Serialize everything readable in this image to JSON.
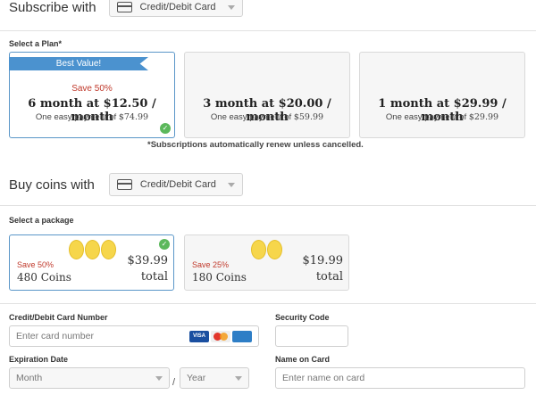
{
  "subscribe": {
    "heading": "Subscribe with",
    "payment_method": "Credit/Debit Card",
    "select_plan_label": "Select a Plan*",
    "plans": [
      {
        "ribbon": "Best Value!",
        "save": "Save 50%",
        "price": "6 month at $12.50 / month",
        "payment_prefix": "One easy payment of ",
        "payment_amount": "$74.99",
        "selected": true
      },
      {
        "ribbon": "",
        "save": "",
        "price": "3 month at $20.00 / month",
        "payment_prefix": "One easy payment of ",
        "payment_amount": "$59.99",
        "selected": false
      },
      {
        "ribbon": "",
        "save": "",
        "price": "1 month at $29.99 / month",
        "payment_prefix": "One easy payment of ",
        "payment_amount": "$29.99",
        "selected": false
      }
    ],
    "renew_note": "*Subscriptions automatically renew unless cancelled."
  },
  "coins": {
    "heading": "Buy coins with",
    "payment_method": "Credit/Debit Card",
    "select_package_label": "Select a package",
    "packages": [
      {
        "save": "Save 50%",
        "count": "480 Coins",
        "price": "$39.99",
        "total": "total",
        "coin_count": 3,
        "selected": true
      },
      {
        "save": "Save 25%",
        "count": "180 Coins",
        "price": "$19.99",
        "total": "total",
        "coin_count": 2,
        "selected": false
      }
    ]
  },
  "form": {
    "card_number_label": "Credit/Debit Card Number",
    "card_number_placeholder": "Enter card number",
    "card_logos": [
      "VISA",
      "MC",
      "AMEX"
    ],
    "security_code_label": "Security Code",
    "security_code_value": "",
    "expiration_label": "Expiration Date",
    "month_value": "Month",
    "year_value": "Year",
    "name_label": "Name on Card",
    "name_placeholder": "Enter name on card"
  },
  "colors": {
    "accent": "#4b92cf",
    "save_red": "#c0392b",
    "check_green": "#5cb85c",
    "coin_gold": "#f6d64b"
  }
}
